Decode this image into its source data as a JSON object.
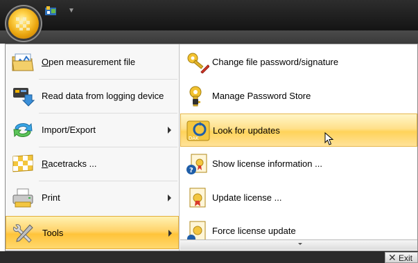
{
  "menu": {
    "left_items": [
      {
        "label": "Open measurement file",
        "mnemonic": "O",
        "icon": "chart-folder-icon",
        "submenu": false
      },
      {
        "label": "Read data from logging device",
        "mnemonic": "",
        "icon": "device-download-icon",
        "submenu": false
      },
      {
        "label": "Import/Export",
        "mnemonic": "",
        "icon": "import-export-icon",
        "submenu": true
      },
      {
        "label": "Racetracks ...",
        "mnemonic": "R",
        "icon": "checkered-flag-icon",
        "submenu": false
      },
      {
        "label": "Print",
        "mnemonic": "",
        "icon": "printer-icon",
        "submenu": true
      },
      {
        "label": "Tools",
        "mnemonic": "",
        "icon": "tools-icon",
        "submenu": true,
        "active": true
      }
    ],
    "right_items": [
      {
        "label": "Change file password/signature",
        "icon": "key-pencil-icon"
      },
      {
        "label": "Manage Password Store",
        "icon": "key-lock-icon"
      },
      {
        "label": "Look for updates",
        "icon": "refresh-update-icon",
        "badge": "DAK",
        "hover": true
      },
      {
        "label": "Show license information ...",
        "icon": "license-info-icon"
      },
      {
        "label": "Update license ...",
        "icon": "license-certificate-icon"
      },
      {
        "label": "Force license update",
        "icon": "license-force-icon"
      }
    ]
  },
  "exit": {
    "label": "Exit"
  },
  "colors": {
    "highlight": "#ffd35a",
    "titlebar": "#1e1e1e"
  }
}
